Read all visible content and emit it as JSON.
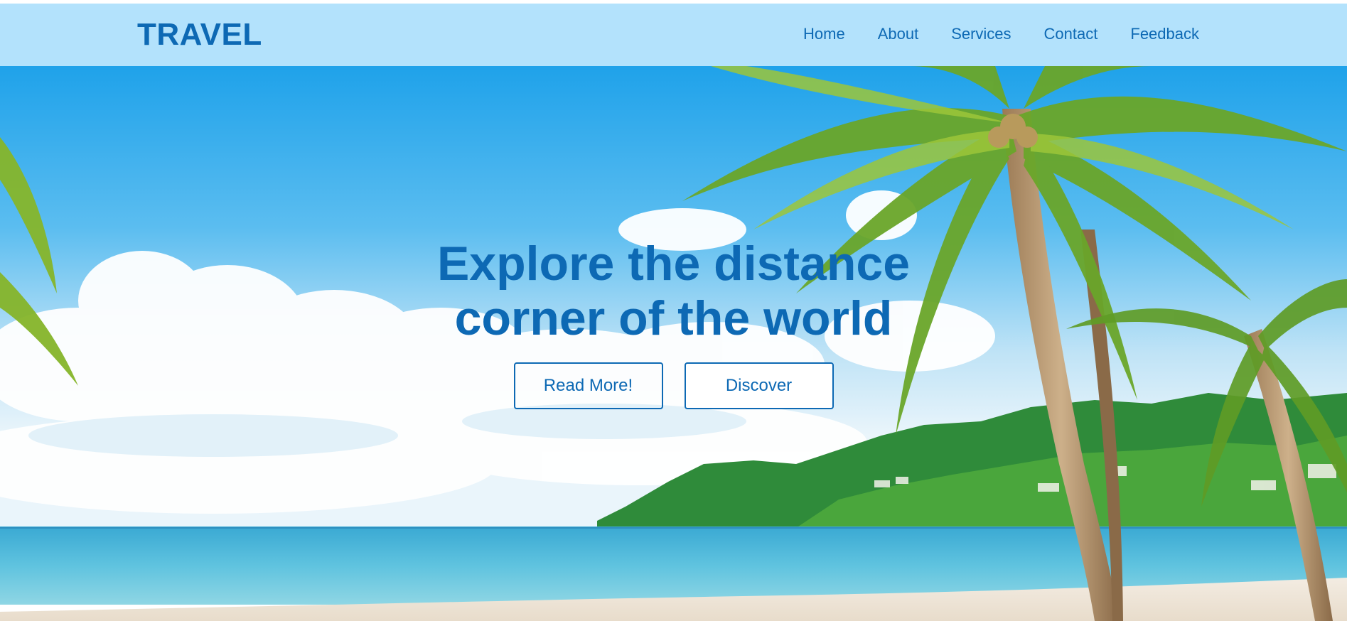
{
  "navbar": {
    "brand": "TRAVEL",
    "links": [
      "Home",
      "About",
      "Services",
      "Contact",
      "Feedback"
    ]
  },
  "hero": {
    "title_line1": "Explore the distance",
    "title_line2": "corner of the world",
    "buttons": {
      "read_more": "Read More!",
      "discover": "Discover"
    },
    "background_description_icon": "beach-palm-scene"
  },
  "colors": {
    "brand_blue": "#0d69b4",
    "navbar_bg": "#b3e2fc",
    "sky_top": "#2aa7ea",
    "sea": "#4cb8d8",
    "sand": "#efe6da"
  }
}
